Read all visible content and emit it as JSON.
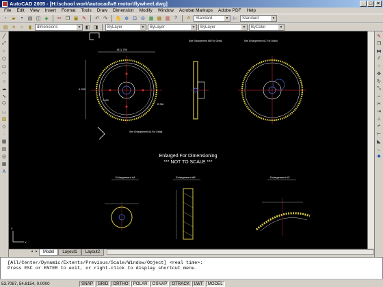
{
  "window": {
    "title": "AutoCAD 2005 - [H:\\school work\\autocad\\v8 motor\\flywheel.dwg]"
  },
  "menu": [
    "File",
    "Edit",
    "View",
    "Insert",
    "Format",
    "Tools",
    "Draw",
    "Dimension",
    "Modify",
    "Window",
    "Acrobat Markups",
    "Adobe PDF",
    "Help"
  ],
  "toolbar": {
    "textstyle": "Standard",
    "dimstyle": "Standard",
    "layer": "dimensions",
    "color": "ByLayer",
    "linetype": "ByLayer",
    "lineweight": "ByLayer",
    "plotstyle": "ByColor"
  },
  "drawing": {
    "note1": "Enlarged For Dimensioning",
    "note2": "*** NOT TO SCALE ***",
    "enl_a": "See Enlargement #A\nFor Detail",
    "enl_b": "See Enlargement #B\nFor Detail",
    "enl_c": "See Enlargement #C\nFor Detail",
    "label_a": "Enlargement #A",
    "label_b": "Enlargement #B",
    "label_c": "Enlargement #C",
    "dim_top": "Ø11.750",
    "dim_h": "9.250",
    "dim_small": "1.000",
    "dim_r": "R.250"
  },
  "tabs": [
    "Model",
    "Layout1",
    "Layout2"
  ],
  "command": {
    "line1": "[All/Center/Dynamic/Extents/Previous/Scale/Window/Object] <real time>:",
    "line2": "Press ESC or ENTER to exit, or right-click to display shortcut menu."
  },
  "status": {
    "coords": "53.7087, 54.8154, 0.0000",
    "buttons": [
      "SNAP",
      "GRID",
      "ORTHO",
      "POLAR",
      "OSNAP",
      "OTRACK",
      "LWT",
      "MODEL"
    ]
  }
}
